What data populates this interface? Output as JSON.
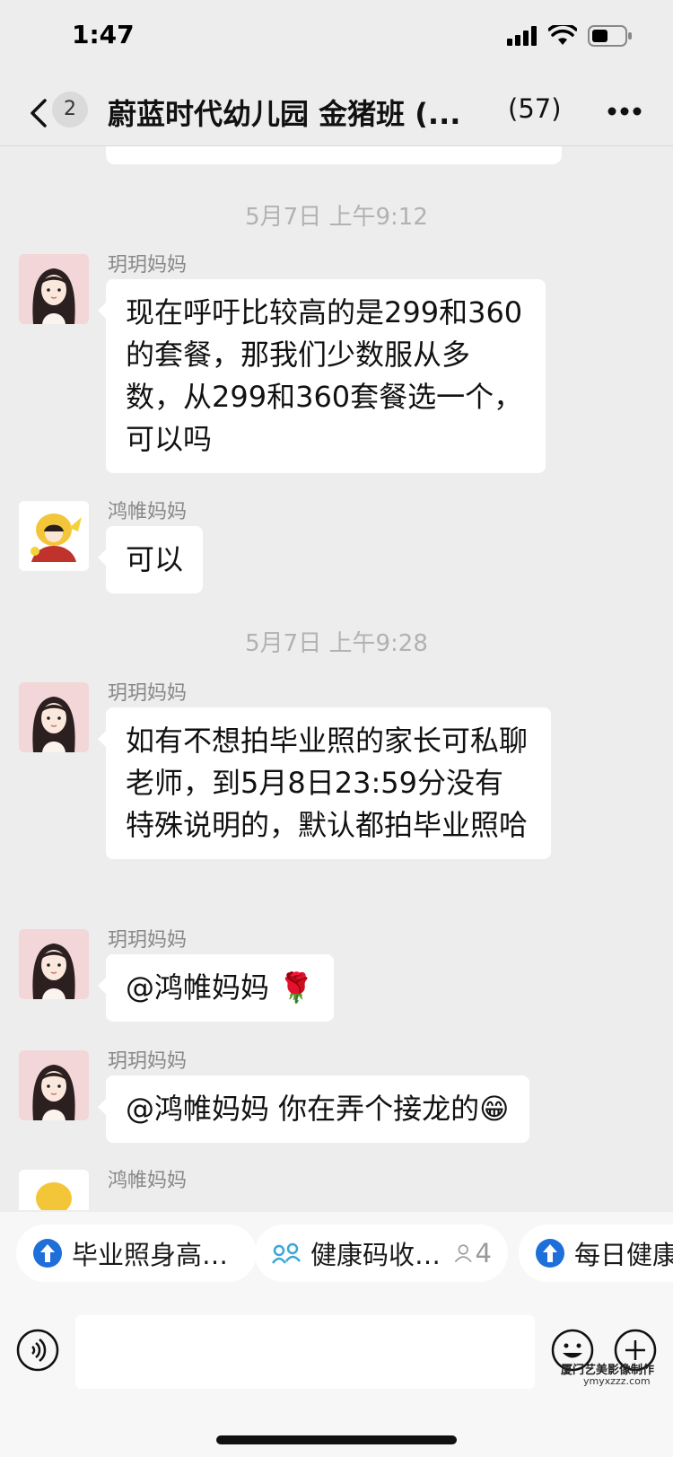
{
  "status_bar": {
    "time": "1:47"
  },
  "nav": {
    "unread_count": "2",
    "title": "蔚蓝时代幼儿园 金猪班 (...",
    "member_count": "(57)"
  },
  "timestamps": [
    "5月7日 上午9:12",
    "5月7日 上午9:28"
  ],
  "messages": [
    {
      "sender": "玥玥妈妈",
      "text": "现在呼吁比较高的是299和360的套餐，那我们少数服从多数，从299和360套餐选一个，可以吗"
    },
    {
      "sender": "鸿帷妈妈",
      "text": "可以"
    },
    {
      "sender": "玥玥妈妈",
      "text": "如有不想拍毕业照的家长可私聊老师，到5月8日23:59分没有特殊说明的，默认都拍毕业照哈"
    },
    {
      "sender": "玥玥妈妈",
      "text": "@鸿帷妈妈 🌹"
    },
    {
      "sender": "玥玥妈妈",
      "text": "@鸿帷妈妈 你在弄个接龙的😁"
    },
    {
      "sender": "鸿帷妈妈",
      "text": ""
    }
  ],
  "quick_bar": [
    {
      "label": "毕业照身高…",
      "icon": "solitaire-icon"
    },
    {
      "label": "健康码收…",
      "icon": "health-code-icon",
      "count": "4"
    },
    {
      "label": "每日健康",
      "icon": "solitaire-icon"
    }
  ],
  "watermark": {
    "line1": "厦门艺美影像制作",
    "line2": "ymyxzzz.com"
  },
  "colors": {
    "background": "#ededed",
    "bubble": "#ffffff",
    "accent_blue": "#1e6fd9",
    "muted_text": "#888888"
  }
}
